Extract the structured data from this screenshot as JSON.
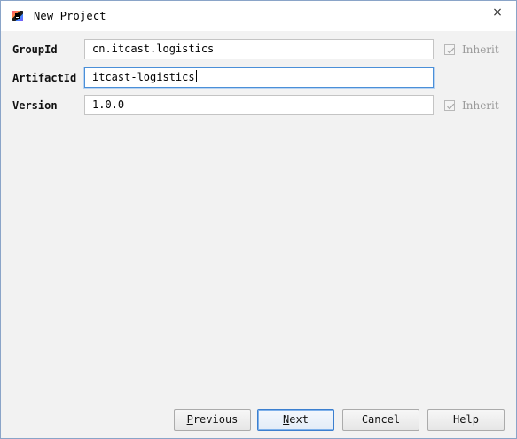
{
  "window": {
    "title": "New Project",
    "close_symbol": "×"
  },
  "icons": {
    "app": "intellij-app-icon",
    "close": "close-icon",
    "check": "checkmark-icon"
  },
  "form": {
    "group_id": {
      "label": "GroupId",
      "value": "cn.itcast.logistics",
      "inherit_label": "Inherit",
      "inherit_checked": true
    },
    "artifact_id": {
      "label": "ArtifactId",
      "value": "itcast-logistics",
      "focused": true
    },
    "version": {
      "label": "Version",
      "value": "1.0.0",
      "inherit_label": "Inherit",
      "inherit_checked": true
    }
  },
  "buttons": {
    "previous": {
      "mnemonic": "P",
      "rest": "revious"
    },
    "next": {
      "mnemonic": "N",
      "rest": "ext"
    },
    "cancel": "Cancel",
    "help": "Help"
  },
  "colors": {
    "focus_border": "#4a8fd8",
    "window_border": "#8aa4c8",
    "background": "#f2f2f2"
  }
}
